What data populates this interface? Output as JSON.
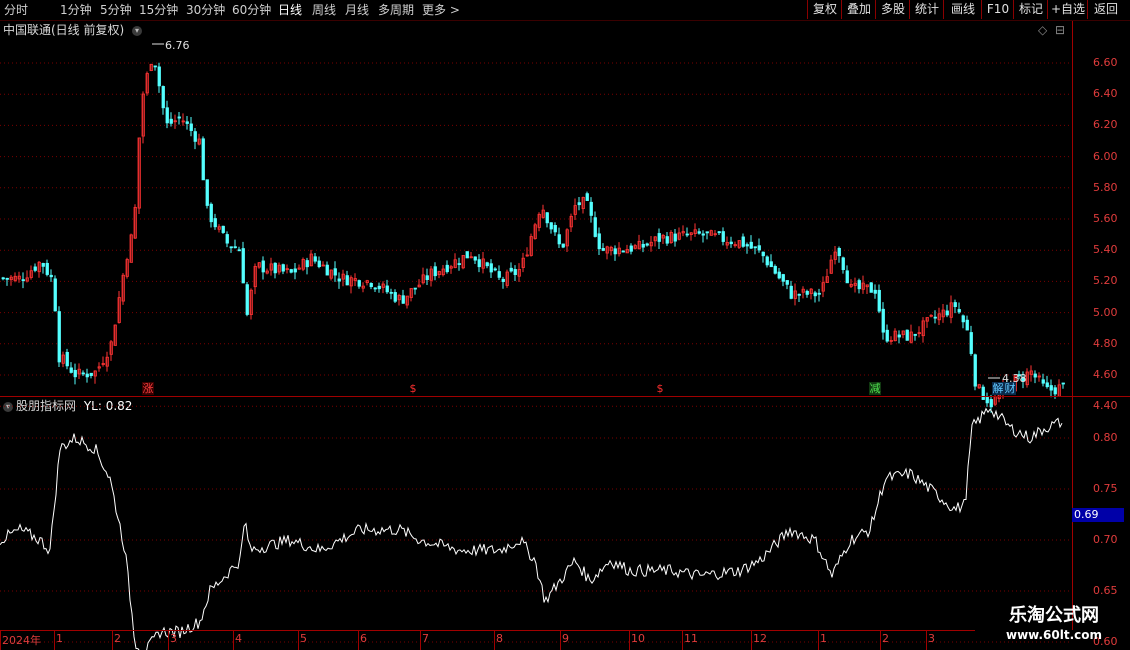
{
  "toolbar": {
    "periods": [
      "分时",
      "1分钟",
      "5分钟",
      "15分钟",
      "30分钟",
      "60分钟",
      "日线",
      "周线",
      "月线",
      "多周期",
      "更多 >"
    ],
    "active_period": "日线",
    "right_buttons": [
      "复权",
      "叠加",
      "多股",
      "统计",
      "画线",
      "F10",
      "标记",
      "+自选",
      "返回"
    ]
  },
  "main_panel": {
    "title": "中国联通(日线 前复权)",
    "diamond_icon": "◇",
    "max_label": "6.76",
    "min_label": "4.38",
    "y_labels": [
      "6.60",
      "6.40",
      "6.20",
      "6.00",
      "5.80",
      "5.60",
      "5.40",
      "5.20",
      "5.00",
      "4.80",
      "4.60",
      "4.40"
    ],
    "markers": [
      {
        "text": "涨",
        "color": "#ff4040",
        "bg": "#3a0000"
      },
      {
        "text": "$",
        "color": "#ff3030",
        "bg": ""
      },
      {
        "text": "$",
        "color": "#ff3030",
        "bg": ""
      },
      {
        "text": "减",
        "color": "#50e050",
        "bg": "#103810"
      },
      {
        "text": "解",
        "color": "#60c8ff",
        "bg": "#0a2a4a"
      },
      {
        "text": "财",
        "color": "#60c8ff",
        "bg": "#0a2a4a"
      }
    ]
  },
  "indicator_panel": {
    "title": "股朋指标网",
    "series_label": "YL: 0.82",
    "y_labels": [
      "0.80",
      "0.75",
      "0.70",
      "0.65",
      "0.60"
    ],
    "current_value": "0.69"
  },
  "x_axis": {
    "labels": [
      "2024年",
      "1",
      "2",
      "3",
      "4",
      "5",
      "6",
      "7",
      "8",
      "9",
      "10",
      "11",
      "12",
      "1",
      "2",
      "3"
    ]
  },
  "watermark": {
    "line1": "乐淘公式网",
    "line2": "www.60lt.com"
  },
  "colors": {
    "up": "#ff3333",
    "down": "#54ffff",
    "grid": "#7a0000",
    "line": "#ffffff"
  }
}
